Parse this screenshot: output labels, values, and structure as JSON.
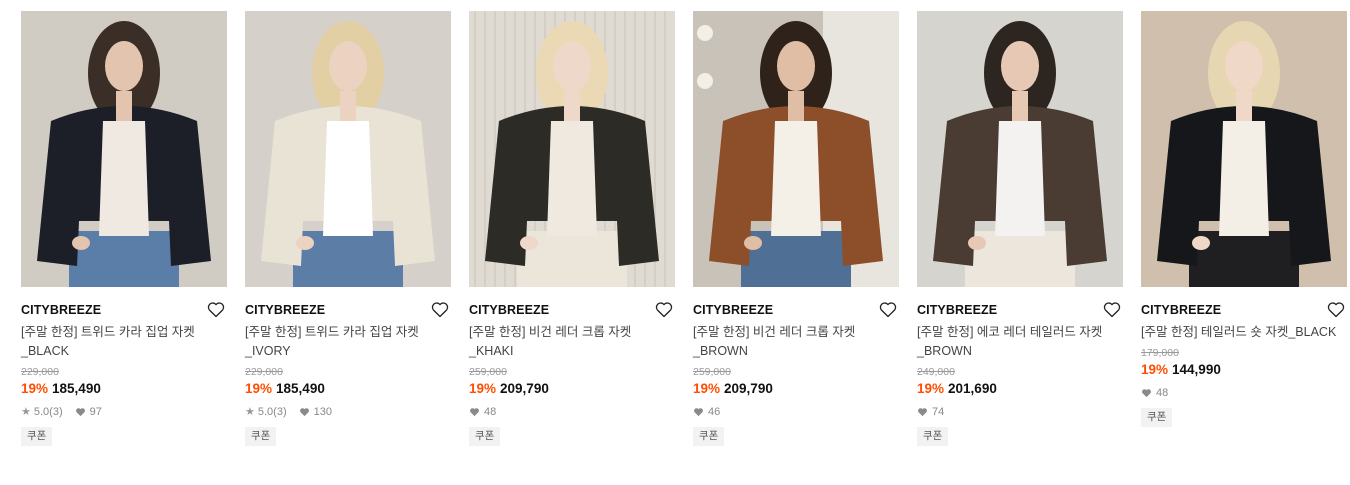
{
  "colors": {
    "discount": "#ff4e00",
    "brand_text": "#111111",
    "name_text": "#444444",
    "muted": "#9a9a9a",
    "coupon_bg": "#f2f2f2"
  },
  "icons": {
    "wishlist": "heart-outline-icon",
    "rating": "star-icon",
    "likes": "heart-filled-icon"
  },
  "products": [
    {
      "brand": "CITYBREEZE",
      "name_line1": "[주말 한정] 트위드 카라 집업 자켓",
      "name_line2": "_BLACK",
      "original_price": "229,000",
      "discount": "19%",
      "price": "185,490",
      "rating": "5.0",
      "reviews": "(3)",
      "likes": "97",
      "coupon": "쿠폰",
      "photo": {
        "bg": "#c8c4bd",
        "wall": "#d7d2ca",
        "coat": "#1c1f27",
        "shirt": "#efe9e1",
        "pants": "#5a7ea8",
        "hair": "#3a2e27",
        "skin": "#e3c4ae"
      }
    },
    {
      "brand": "CITYBREEZE",
      "name_line1": "[주말 한정] 트위드 카라 집업 자켓",
      "name_line2": "_IVORY",
      "original_price": "229,000",
      "discount": "19%",
      "price": "185,490",
      "rating": "5.0",
      "reviews": "(3)",
      "likes": "130",
      "coupon": "쿠폰",
      "photo": {
        "bg": "#cfcbc4",
        "wall": "#dbd7d0",
        "coat": "#e9e3d6",
        "shirt": "#ffffff",
        "pants": "#5b7da6",
        "hair": "#e2cfa4",
        "skin": "#ecd2c0"
      }
    },
    {
      "brand": "CITYBREEZE",
      "name_line1": "[주말 한정] 비건 레더 크롭 자켓",
      "name_line2": "_KHAKI",
      "original_price": "259,000",
      "discount": "19%",
      "price": "209,790",
      "rating": "",
      "reviews": "",
      "likes": "48",
      "coupon": "쿠폰",
      "photo": {
        "bg": "#d9d4cc",
        "wall": "#e6e1d9",
        "coat": "#2c2b25",
        "shirt": "#efe9df",
        "pants": "#ece6da",
        "hair": "#ead9b4",
        "skin": "#eed8c9"
      }
    },
    {
      "brand": "CITYBREEZE",
      "name_line1": "[주말 한정] 비건 레더 크롭 자켓",
      "name_line2": "_BROWN",
      "original_price": "259,000",
      "discount": "19%",
      "price": "209,790",
      "rating": "",
      "reviews": "",
      "likes": "46",
      "coupon": "쿠폰",
      "photo": {
        "bg": "#b9b2a7",
        "wall": "#d8d2c9",
        "coat": "#8c4f2a",
        "shirt": "#f4efe7",
        "pants": "#4f6f95",
        "hair": "#2e221b",
        "skin": "#e0bda5"
      }
    },
    {
      "brand": "CITYBREEZE",
      "name_line1": "[주말 한정] 에코 레더 테일러드 자켓",
      "name_line2": "_BROWN",
      "original_price": "249,000",
      "discount": "19%",
      "price": "201,690",
      "rating": "",
      "reviews": "",
      "likes": "74",
      "coupon": "쿠폰",
      "photo": {
        "bg": "#cfccc6",
        "wall": "#dedbd5",
        "coat": "#4a3b33",
        "shirt": "#f4f2f0",
        "pants": "#ece6dc",
        "hair": "#2d2520",
        "skin": "#e6c8b5"
      }
    },
    {
      "brand": "CITYBREEZE",
      "name_line1": "[주말 한정] 테일러드 숏 자켓_BLACK",
      "name_line2": "",
      "original_price": "179,000",
      "discount": "19%",
      "price": "144,990",
      "rating": "",
      "reviews": "",
      "likes": "48",
      "coupon": "쿠폰",
      "photo": {
        "bg": "#c9b8a6",
        "wall": "#d6c5b2",
        "coat": "#15171b",
        "shirt": "#f3eee6",
        "pants": "#1f1f22",
        "hair": "#e6d6b2",
        "skin": "#efd8c8"
      }
    }
  ]
}
